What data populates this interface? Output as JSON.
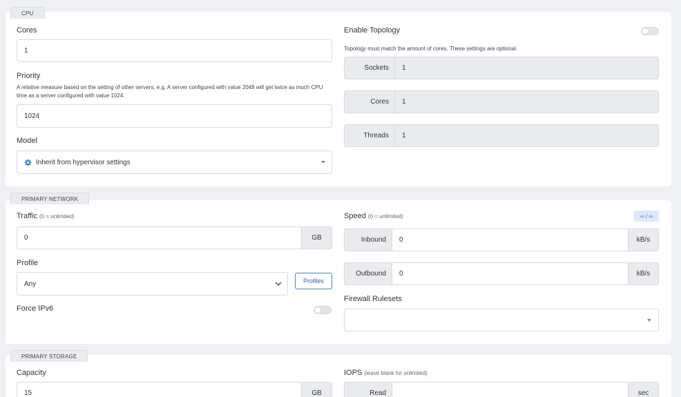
{
  "cpu": {
    "tab": "CPU",
    "cores_label": "Cores",
    "cores_value": "1",
    "priority_label": "Priority",
    "priority_desc": "A relative measure based on the setting of other servers, e.g. A server configured with value 2048 will get twice as much CPU time as a server configured with value 1024.",
    "priority_value": "1024",
    "model_label": "Model",
    "model_value": "Inherit from hypervisor settings",
    "topology_label": "Enable Topology",
    "topology_note": "Topology must match the amount of cores. These settings are optional.",
    "sockets_label": "Sockets",
    "sockets_value": "1",
    "topo_cores_label": "Cores",
    "topo_cores_value": "1",
    "threads_label": "Threads",
    "threads_value": "1"
  },
  "network": {
    "tab": "PRIMARY NETWORK",
    "traffic_label": "Traffic",
    "traffic_hint": "(0 = unlimited)",
    "traffic_value": "0",
    "traffic_unit": "GB",
    "profile_label": "Profile",
    "profile_value": "Any",
    "profiles_button": "Profiles",
    "force_ipv6_label": "Force IPv6",
    "speed_label": "Speed",
    "speed_hint": "(0 = unlimited)",
    "speed_badge": "∞ / ∞",
    "inbound_label": "Inbound",
    "inbound_value": "0",
    "inbound_unit": "kB/s",
    "outbound_label": "Outbound",
    "outbound_value": "0",
    "outbound_unit": "kB/s",
    "firewall_label": "Firewall Rulesets"
  },
  "storage": {
    "tab": "PRIMARY STORAGE",
    "capacity_label": "Capacity",
    "capacity_value": "15",
    "capacity_unit": "GB",
    "iops_label": "IOPS",
    "iops_hint": "(leave blank for unlimited)",
    "read_label": "Read",
    "read_value": "",
    "read_unit": "sec"
  },
  "colors": {
    "accent": "#4a7fc1",
    "badge_bg": "#dbe9fb",
    "disabled_bg": "#e9ebee"
  }
}
